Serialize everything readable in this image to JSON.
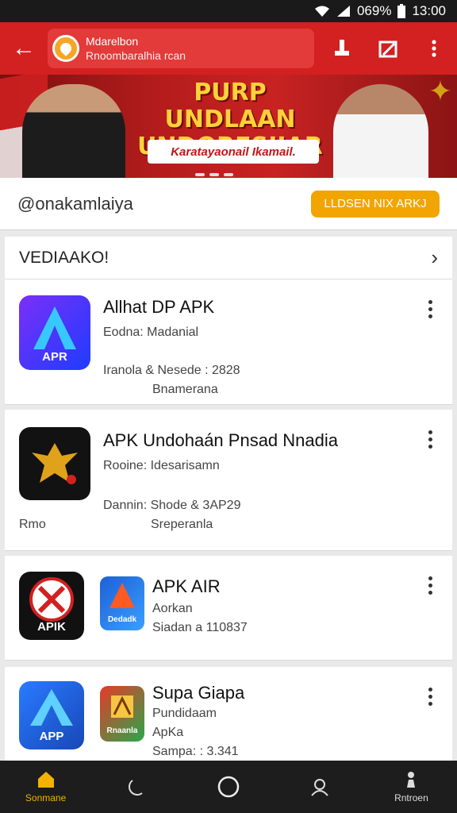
{
  "status_bar": {
    "battery": "069%",
    "time": "13:00"
  },
  "app_bar": {
    "url_title": "Mdarelbon",
    "url_sub": "Rnoombaralhia  rcan",
    "colors": {
      "bar": "#d32020",
      "accent": "#f2a500"
    }
  },
  "banner": {
    "headline_1": "PURP UNDLAAN",
    "headline_2": "UNDORESIIAR",
    "ribbon": "Karatayaonail Ikamail."
  },
  "account": {
    "handle": "@onakamlaiya",
    "cta": "LLDSEN NIX ARKJ"
  },
  "section": {
    "title": "VEDIAAKO!"
  },
  "apps": [
    {
      "title": "Allhat DP APK",
      "line1": "Eodna: Madanial",
      "line2": "Iranola & Nesede : 2828",
      "line3": "Bnamerana",
      "icon_label": "APR",
      "extra": ""
    },
    {
      "title": "APK Undohaán Pnsad Nnadia",
      "line1": "Rooine: Idesarisamn",
      "line2": "Dannin: Shode & 3AP29",
      "line3": "Sreperanla",
      "icon_label": "",
      "extra": "Rmo"
    },
    {
      "title": "APK AIR",
      "line1": "Aorkan",
      "line2": "Siadan a 110837",
      "line3": "",
      "icon_label": "APIK",
      "icon2_label": "Dedadk"
    },
    {
      "title": "Supa Giapa",
      "line1": "Pundidaam",
      "line2": "ApKa",
      "line3": "Sampa: : 3.341",
      "icon_label": "APP",
      "icon2_label": "Rnaanla"
    }
  ],
  "bottom_nav": [
    {
      "label": "Sonmane",
      "icon": "home-icon"
    },
    {
      "label": "",
      "icon": "moon-icon"
    },
    {
      "label": "",
      "icon": "circle-icon"
    },
    {
      "label": "",
      "icon": "profile-icon"
    },
    {
      "label": "Rntroen",
      "icon": "pawn-icon"
    }
  ]
}
